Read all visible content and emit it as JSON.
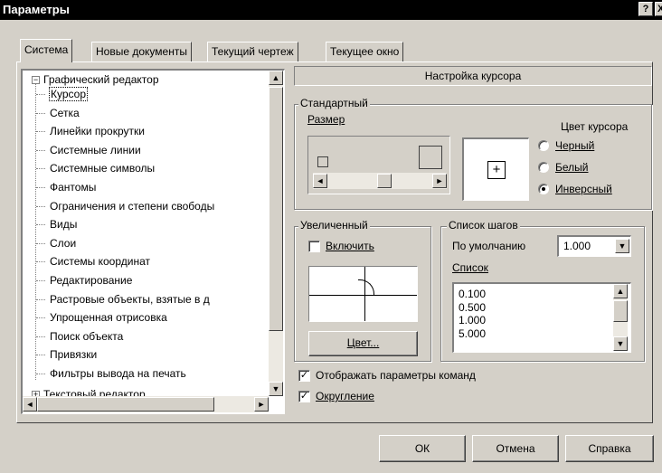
{
  "window": {
    "title": "Параметры",
    "help_button": "?",
    "close_button": "X"
  },
  "tabs": [
    {
      "label": "Система",
      "active": true
    },
    {
      "label": "Новые документы",
      "active": false
    },
    {
      "label": "Текущий чертеж",
      "active": false
    },
    {
      "label": "Текущее окно",
      "active": false
    }
  ],
  "tree": {
    "root_expander": "−",
    "root_label": "Графический редактор",
    "items": [
      "Курсор",
      "Сетка",
      "Линейки прокрутки",
      "Системные линии",
      "Системные символы",
      "Фантомы",
      "Ограничения и степени свободы",
      "Виды",
      "Слои",
      "Системы координат",
      "Редактирование",
      "Растровые объекты, взятые в д",
      "Упрощенная отрисовка",
      "Поиск объекта",
      "Привязки",
      "Фильтры вывода на печать"
    ],
    "selected_index": 0,
    "last_expander": "+",
    "last_label": "Текстовый редактор"
  },
  "settings": {
    "header": "Настройка курсора",
    "standard": {
      "title": "Стандартный",
      "size_label": "Размер",
      "color_label": "Цвет курсора",
      "colors": [
        {
          "label": "Черный",
          "checked": false
        },
        {
          "label": "Белый",
          "checked": false
        },
        {
          "label": "Инверсный",
          "checked": true
        }
      ],
      "slider_fraction": 0.55,
      "preview_glyph": "+"
    },
    "zoomed": {
      "title": "Увеличенный",
      "enable_label": "Включить",
      "enable_checked": false,
      "color_button": "Цвет..."
    },
    "steps": {
      "title": "Список шагов",
      "default_label": "По умолчанию",
      "default_value": "1.000",
      "list_label": "Список",
      "list_values": [
        "0.100",
        "0.500",
        "1.000",
        "5.000"
      ]
    },
    "show_params": {
      "label": "Отображать параметры команд",
      "checked": true
    },
    "rounding": {
      "label": "Округление",
      "checked": true
    }
  },
  "buttons": {
    "ok": "ОК",
    "cancel": "Отмена",
    "help": "Справка"
  },
  "icons": {
    "up_arrow": "▲",
    "down_arrow": "▼",
    "left_arrow": "◄",
    "right_arrow": "►",
    "check": "✓"
  }
}
